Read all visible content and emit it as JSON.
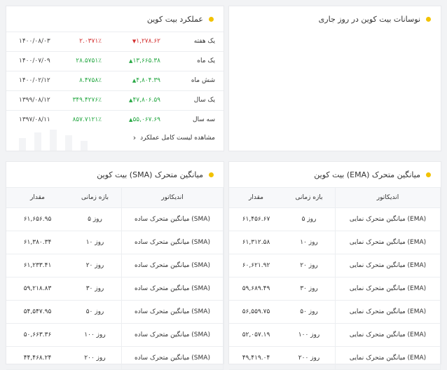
{
  "volatility": {
    "title": "نوسانات بیت کوین در روز جاری"
  },
  "performance": {
    "title": "عملکرد بیت کوین",
    "rows": [
      {
        "label": "یک هفته",
        "change": "۱,۲۷۸.۶۲",
        "direction": "down",
        "percent": "۲.۰۳۷۱٪",
        "date": "۱۴۰۰/۰۸/۰۳"
      },
      {
        "label": "یک ماه",
        "change": "۱۳,۶۶۵.۳۸",
        "direction": "up",
        "percent": "۲۸.۵۷۵۱٪",
        "date": "۱۴۰۰/۰۷/۰۹"
      },
      {
        "label": "شش ماه",
        "change": "۴,۸۰۴.۳۹",
        "direction": "up",
        "percent": "۸.۴۷۵۸٪",
        "date": "۱۴۰۰/۰۲/۱۲"
      },
      {
        "label": "یک سال",
        "change": "۴۷,۸۰۶.۵۹",
        "direction": "up",
        "percent": "۳۴۹.۴۲۷۶٪",
        "date": "۱۳۹۹/۰۸/۱۲"
      },
      {
        "label": "سه سال",
        "change": "۵۵,۰۶۷.۶۹",
        "direction": "up",
        "percent": "۸۵۷.۷۱۲۱٪",
        "date": "۱۳۹۷/۰۸/۱۱"
      }
    ],
    "link_label": "مشاهده لیست کامل عملکرد",
    "colors": {
      "up": "#27a844",
      "down": "#d32f2f"
    }
  },
  "ema": {
    "title": "میانگین متحرک (EMA) بیت کوین",
    "headers": {
      "indicator": "اندیکاتور",
      "period": "بازه زمانی",
      "value": "مقدار"
    },
    "rows": [
      {
        "indicator": "میانگین متحرک نمایی (EMA)",
        "period": "۵ روز",
        "value": "۶۱,۴۵۶.۶۷"
      },
      {
        "indicator": "میانگین متحرک نمایی (EMA)",
        "period": "۱۰ روز",
        "value": "۶۱,۳۱۲.۵۸"
      },
      {
        "indicator": "میانگین متحرک نمایی (EMA)",
        "period": "۲۰ روز",
        "value": "۶۰,۶۲۱.۹۲"
      },
      {
        "indicator": "میانگین متحرک نمایی (EMA)",
        "period": "۳۰ روز",
        "value": "۵۹,۶۸۹.۴۹"
      },
      {
        "indicator": "میانگین متحرک نمایی (EMA)",
        "period": "۵۰ روز",
        "value": "۵۶,۵۵۹.۷۵"
      },
      {
        "indicator": "میانگین متحرک نمایی (EMA)",
        "period": "۱۰۰ روز",
        "value": "۵۲,۰۵۷.۱۹"
      },
      {
        "indicator": "میانگین متحرک نمایی (EMA)",
        "period": "۲۰۰ روز",
        "value": "۴۹,۴۱۹.۰۴"
      }
    ]
  },
  "sma": {
    "title": "میانگین متحرک (SMA) بیت کوین",
    "headers": {
      "indicator": "اندیکاتور",
      "period": "بازه زمانی",
      "value": "مقدار"
    },
    "rows": [
      {
        "indicator": "میانگین متحرک ساده (SMA)",
        "period": "۵ روز",
        "value": "۶۱,۶۵۶.۹۵"
      },
      {
        "indicator": "میانگین متحرک ساده (SMA)",
        "period": "۱۰ روز",
        "value": "۶۱,۳۸۰.۳۴"
      },
      {
        "indicator": "میانگین متحرک ساده (SMA)",
        "period": "۲۰ روز",
        "value": "۶۱,۲۳۳.۴۱"
      },
      {
        "indicator": "میانگین متحرک ساده (SMA)",
        "period": "۳۰ روز",
        "value": "۵۹,۲۱۸.۸۳"
      },
      {
        "indicator": "میانگین متحرک ساده (SMA)",
        "period": "۵۰ روز",
        "value": "۵۴,۵۴۷.۹۵"
      },
      {
        "indicator": "میانگین متحرک ساده (SMA)",
        "period": "۱۰۰ روز",
        "value": "۵۰,۶۶۳.۳۶"
      },
      {
        "indicator": "میانگین متحرک ساده (SMA)",
        "period": "۲۰۰ روز",
        "value": "۴۴,۴۶۸.۲۴"
      }
    ]
  },
  "theme": {
    "accent_dot": "#f2c200"
  }
}
